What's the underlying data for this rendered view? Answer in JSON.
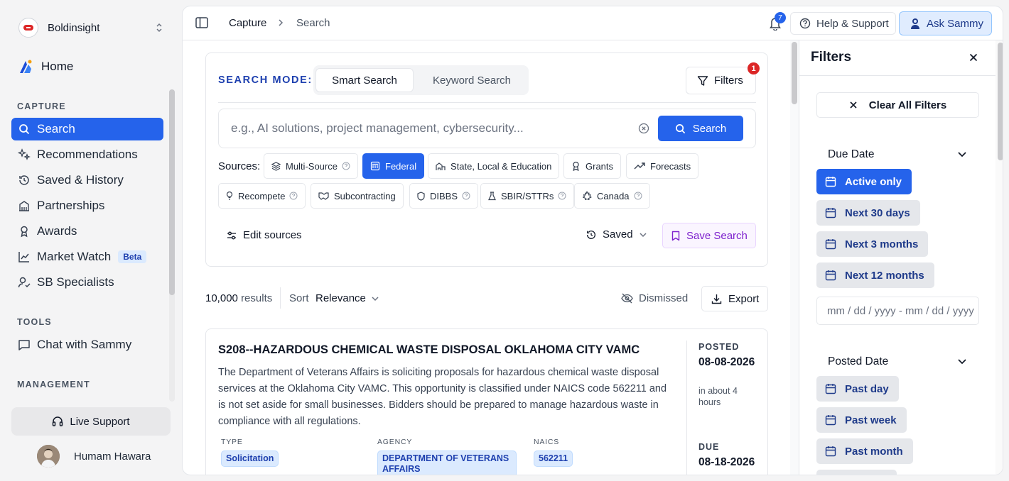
{
  "sidebar": {
    "org_name": "Boldinsight",
    "home_label": "Home",
    "capture_label": "CAPTURE",
    "capture_items": [
      {
        "label": "Search",
        "icon": "search-icon"
      },
      {
        "label": "Recommendations",
        "icon": "sparkles-icon"
      },
      {
        "label": "Saved & History",
        "icon": "history-icon"
      },
      {
        "label": "Partnerships",
        "icon": "building-icon"
      },
      {
        "label": "Awards",
        "icon": "award-icon"
      },
      {
        "label": "Market Watch",
        "icon": "chart-icon",
        "badge": "Beta"
      },
      {
        "label": "SB Specialists",
        "icon": "user-check-icon"
      }
    ],
    "tools_label": "TOOLS",
    "tools_items": [
      {
        "label": "Chat with Sammy",
        "icon": "chat-icon"
      }
    ],
    "management_label": "MANAGEMENT",
    "live_support": "Live Support",
    "user_name": "Humam Hawara"
  },
  "topbar": {
    "breadcrumb": [
      "Capture",
      "Search"
    ],
    "notification_count": "7",
    "help_label": "Help & Support",
    "ask_label": "Ask Sammy"
  },
  "search": {
    "mode_label": "SEARCH MODE:",
    "modes": [
      "Smart Search",
      "Keyword Search"
    ],
    "active_mode": "Smart Search",
    "filters_label": "Filters",
    "filters_count": "1",
    "placeholder": "e.g., AI solutions, project management, cybersecurity...",
    "value": "",
    "search_button": "Search",
    "sources_label": "Sources:",
    "sources": [
      {
        "label": "Multi-Source",
        "active": false
      },
      {
        "label": "Federal",
        "active": true
      },
      {
        "label": "State, Local & Education",
        "active": false
      },
      {
        "label": "Grants",
        "active": false
      },
      {
        "label": "Forecasts",
        "active": false
      },
      {
        "label": "Recompete",
        "active": false
      },
      {
        "label": "Subcontracting",
        "active": false
      },
      {
        "label": "DIBBS",
        "active": false
      },
      {
        "label": "SBIR/STTRs",
        "active": false
      },
      {
        "label": "Canada",
        "active": false
      }
    ],
    "edit_sources": "Edit sources",
    "saved_label": "Saved",
    "save_search": "Save Search"
  },
  "results": {
    "count": "10,000",
    "count_suffix": "results",
    "sort_label": "Sort",
    "sort_value": "Relevance",
    "dismissed_label": "Dismissed",
    "export_label": "Export",
    "items": [
      {
        "title": "S208--HAZARDOUS CHEMICAL WASTE DISPOSAL OKLAHOMA CITY VAMC",
        "description": "The Department of Veterans Affairs is soliciting proposals for hazardous chemical waste disposal services at the Oklahoma City VAMC. This opportunity is classified under NAICS code 562211 and is not set aside for small businesses. Bidders should be prepared to manage hazardous waste in compliance with all regulations.",
        "type_label": "TYPE",
        "type": "Solicitation",
        "agency_label": "AGENCY",
        "agency": "DEPARTMENT OF VETERANS AFFAIRS",
        "naics_label": "NAICS",
        "naics": "562211",
        "posted_label": "POSTED",
        "posted_date": "08-08-2026",
        "posted_relative": "in about 4 hours",
        "due_label": "DUE",
        "due_date": "08-18-2026"
      }
    ]
  },
  "filters_panel": {
    "title": "Filters",
    "clear_all": "Clear All Filters",
    "due_date_label": "Due Date",
    "due_options": [
      {
        "label": "Active only",
        "active": true
      },
      {
        "label": "Next 30 days",
        "active": false
      },
      {
        "label": "Next 3 months",
        "active": false
      },
      {
        "label": "Next 12 months",
        "active": false
      }
    ],
    "date_range_text": "mm / dd / yyyy  -  mm / dd / yyyy",
    "posted_date_label": "Posted Date",
    "posted_options": [
      {
        "label": "Past day",
        "active": false
      },
      {
        "label": "Past week",
        "active": false
      },
      {
        "label": "Past month",
        "active": false
      }
    ]
  },
  "colors": {
    "accent": "#2563eb",
    "badge_red": "#dc2626",
    "save_purple": "#7e22ce"
  }
}
